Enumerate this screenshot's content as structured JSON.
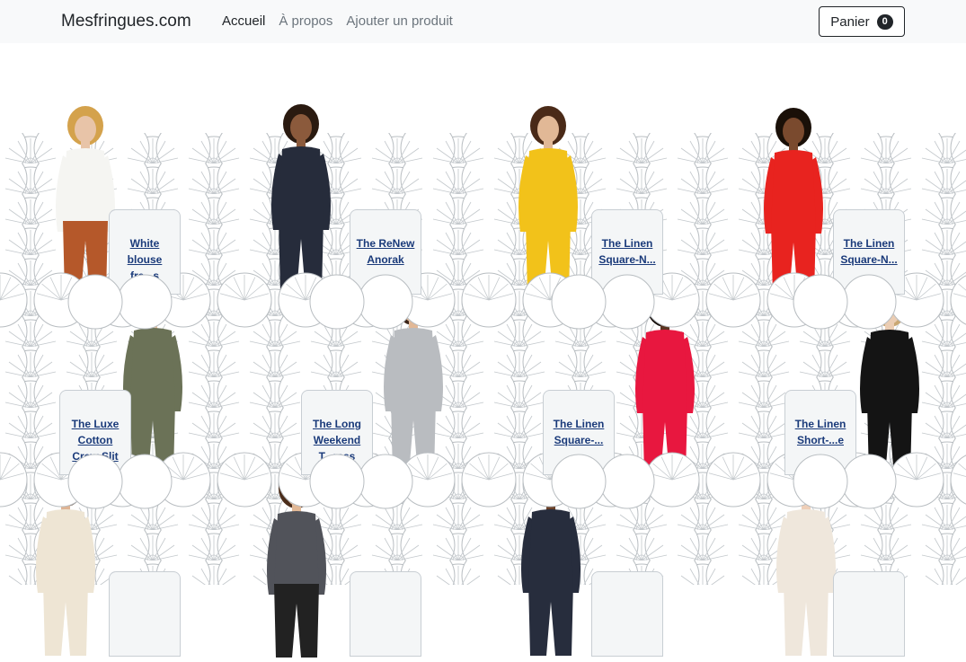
{
  "navbar": {
    "brand": "Mesfringues.com",
    "links": [
      {
        "label": "Accueil",
        "active": true
      },
      {
        "label": "À propos",
        "active": false
      },
      {
        "label": "Ajouter un produit",
        "active": false
      }
    ],
    "cart": {
      "label": "Panier",
      "count": "0"
    }
  },
  "products": [
    {
      "name": "White blouse fre...s",
      "outfit": "white-blouse",
      "colors": {
        "top": "#f5f5f2",
        "bottom": "#b5582a",
        "skin": "#e8c4a8",
        "hair": "#d4a24c"
      }
    },
    {
      "name": "The ReNew Anorak",
      "outfit": "navy-anorak",
      "colors": {
        "top": "#262c3b",
        "bottom": "#262c3b",
        "skin": "#8b5a3c",
        "hair": "#2a1a10"
      }
    },
    {
      "name": "The Linen Square-N...",
      "outfit": "yellow-jumpsuit",
      "colors": {
        "top": "#f2c21a",
        "bottom": "#f2c21a",
        "skin": "#e1b896",
        "hair": "#4a2a18"
      }
    },
    {
      "name": "The Linen Square-N...",
      "outfit": "red-jumpsuit",
      "colors": {
        "top": "#e8231f",
        "bottom": "#e8231f",
        "skin": "#7a4a2e",
        "hair": "#1a1008"
      }
    },
    {
      "name": "The Luxe Cotton Crew Slit",
      "outfit": "olive-dress",
      "colors": {
        "top": "#6b7257",
        "bottom": "#6b7257",
        "skin": "#e6c1a0",
        "hair": "#5a3a22"
      }
    },
    {
      "name": "The Long Weekend T...ress",
      "outfit": "grey-overalls",
      "colors": {
        "top": "#b9bcc0",
        "bottom": "#b9bcc0",
        "skin": "#e2b896",
        "hair": "#3a2418"
      }
    },
    {
      "name": "The Linen Square-...",
      "outfit": "pink-dress",
      "colors": {
        "top": "#e8173f",
        "bottom": "#e8173f",
        "skin": "#5a3522",
        "hair": "#140c08"
      }
    },
    {
      "name": "The Linen Short-...e",
      "outfit": "black-jumpsuit",
      "colors": {
        "top": "#141414",
        "bottom": "#141414",
        "skin": "#ebcdb3",
        "hair": "#c9a874"
      }
    },
    {
      "name": "",
      "outfit": "cream-jacket",
      "colors": {
        "top": "#eee5d4",
        "bottom": "#eee5d4",
        "skin": "#dfb494",
        "hair": "#4a2c1a"
      }
    },
    {
      "name": "",
      "outfit": "grey-sweater",
      "colors": {
        "top": "#51535a",
        "bottom": "#222",
        "skin": "#e1b896",
        "hair": "#4a2c1a"
      }
    },
    {
      "name": "",
      "outfit": "navy-coat",
      "colors": {
        "top": "#272d3d",
        "bottom": "#272d3d",
        "skin": "#6a4028",
        "hair": "#120a06"
      }
    },
    {
      "name": "",
      "outfit": "cream-coat",
      "colors": {
        "top": "#efe7dc",
        "bottom": "#efe7dc",
        "skin": "#efcfb8",
        "hair": "#b5653a"
      }
    }
  ]
}
